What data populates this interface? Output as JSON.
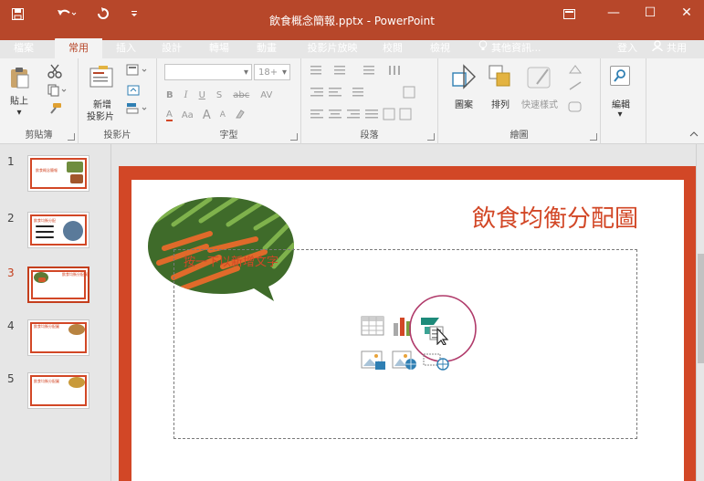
{
  "titlebar": {
    "doc_title": "飲食概念簡報.pptx - PowerPoint",
    "save_icon": "save-icon",
    "undo_icon": "undo-icon",
    "redo_icon": "repeat-icon",
    "qat_icon": "customize-qat-icon",
    "ribbon_options_icon": "ribbon-display-options-icon",
    "minimize": "—",
    "maximize": "☐",
    "close": "✕",
    "color": "#b7472a"
  },
  "tabs": [
    {
      "label": "檔案"
    },
    {
      "label": "常用",
      "active": true
    },
    {
      "label": "插入"
    },
    {
      "label": "設計"
    },
    {
      "label": "轉場"
    },
    {
      "label": "動畫"
    },
    {
      "label": "投影片放映"
    },
    {
      "label": "校閱"
    },
    {
      "label": "檢視"
    }
  ],
  "tellme": "其他資訊...",
  "signin": "登入",
  "share": "共用",
  "ribbon": {
    "clipboard": {
      "label": "剪貼簿",
      "paste": "貼上"
    },
    "slides": {
      "label": "投影片",
      "new_slide_1": "新增",
      "new_slide_2": "投影片"
    },
    "font": {
      "label": "字型",
      "size": "18+",
      "btns": [
        "B",
        "I",
        "U",
        "S",
        "abc",
        "AV"
      ],
      "row2": [
        "A",
        "Aa",
        "A",
        "A"
      ]
    },
    "paragraph": {
      "label": "段落"
    },
    "drawing": {
      "label": "繪圖",
      "shapes": "圖案",
      "arrange": "排列",
      "quick_styles": "快速樣式"
    },
    "editing": {
      "label": "編輯"
    }
  },
  "thumbnails": [
    {
      "num": "1",
      "title": "飲食概念簡報"
    },
    {
      "num": "2",
      "title": "飲食均衡分配"
    },
    {
      "num": "3",
      "title": "飲食均衡分配圖",
      "selected": true
    },
    {
      "num": "4",
      "title": "飲食均衡分配圖"
    },
    {
      "num": "5",
      "title": "飲食均衡分配圖"
    }
  ],
  "slide": {
    "title": "飲食均衡分配圖",
    "placeholder_text": "按一下以新增文字",
    "accent": "#d24726"
  },
  "content_icons": [
    "insert-table-icon",
    "insert-chart-icon",
    "insert-smartart-icon",
    "insert-picture-icon",
    "insert-online-picture-icon",
    "insert-video-icon"
  ]
}
